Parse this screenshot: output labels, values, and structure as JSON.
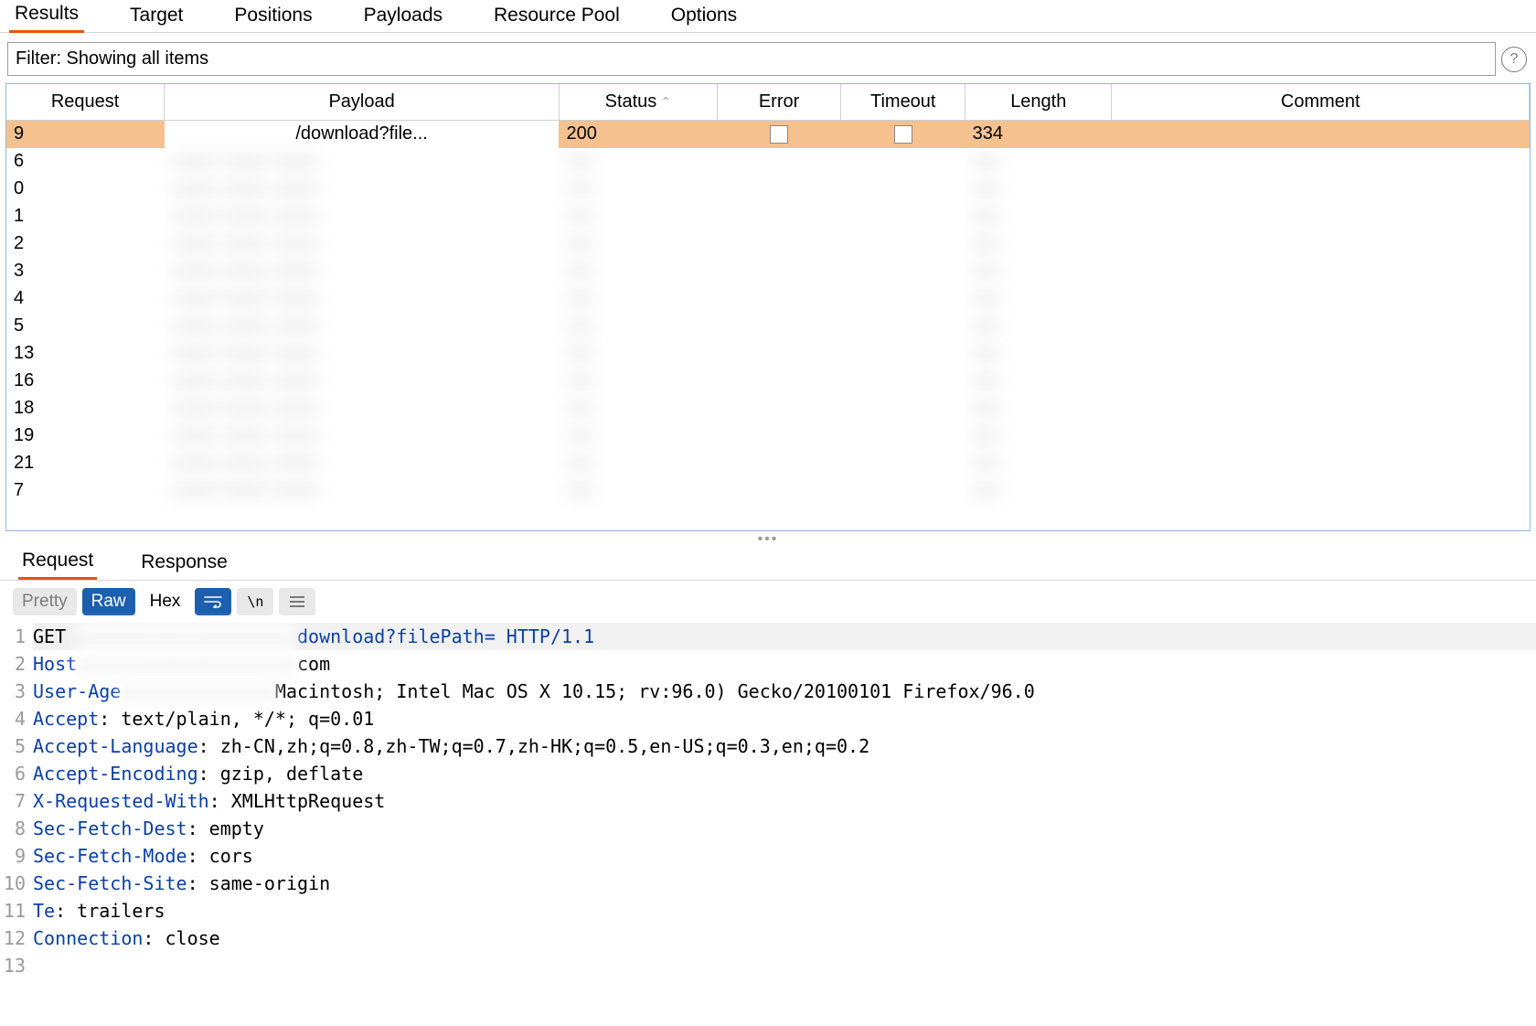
{
  "topTabs": [
    "Results",
    "Target",
    "Positions",
    "Payloads",
    "Resource Pool",
    "Options"
  ],
  "topTabActive": 0,
  "filterText": "Filter: Showing all items",
  "columns": [
    "Request",
    "Payload",
    "Status",
    "Error",
    "Timeout",
    "Length",
    "Comment"
  ],
  "sortedColIndex": 2,
  "selectedRow": {
    "request": "9",
    "payload": "/download?file...",
    "status": "200",
    "length": "334"
  },
  "otherRowRequests": [
    "6",
    "0",
    "1",
    "2",
    "3",
    "4",
    "5",
    "13",
    "16",
    "18",
    "19",
    "21",
    "7"
  ],
  "lowerTabs": [
    "Request",
    "Response"
  ],
  "lowerTabActive": 0,
  "viewModes": {
    "pretty": "Pretty",
    "raw": "Raw",
    "hex": "Hex",
    "newline": "\\n"
  },
  "request": {
    "lines": [
      {
        "n": 1,
        "plain": "GET ",
        "redact": "xxxxxxxxxxxxxxxxxxxx",
        "after": "download?filePath= HTTP/1.1",
        "kw": true,
        "bg": true
      },
      {
        "n": 2,
        "hdr": "Host",
        "redact": "xxxxxxxxxxxxxxxxxxxx",
        "after": "com"
      },
      {
        "n": 3,
        "hdr": "User-Age",
        "redact": "xxxxxxxxxxxxxx",
        "after": "Macintosh; Intel Mac OS X 10.15; rv:96.0) Gecko/20100101 Firefox/96.0"
      },
      {
        "n": 4,
        "hdr": "Accept",
        "val": " text/plain, */*; q=0.01"
      },
      {
        "n": 5,
        "hdr": "Accept-Language",
        "val": " zh-CN,zh;q=0.8,zh-TW;q=0.7,zh-HK;q=0.5,en-US;q=0.3,en;q=0.2"
      },
      {
        "n": 6,
        "hdr": "Accept-Encoding",
        "val": " gzip, deflate"
      },
      {
        "n": 7,
        "hdr": "X-Requested-With",
        "val": " XMLHttpRequest"
      },
      {
        "n": 8,
        "hdr": "Sec-Fetch-Dest",
        "val": " empty"
      },
      {
        "n": 9,
        "hdr": "Sec-Fetch-Mode",
        "val": " cors"
      },
      {
        "n": 10,
        "hdr": "Sec-Fetch-Site",
        "val": " same-origin"
      },
      {
        "n": 11,
        "hdr": "Te",
        "val": " trailers"
      },
      {
        "n": 12,
        "hdr": "Connection",
        "val": " close"
      },
      {
        "n": 13,
        "blank": true
      }
    ]
  }
}
